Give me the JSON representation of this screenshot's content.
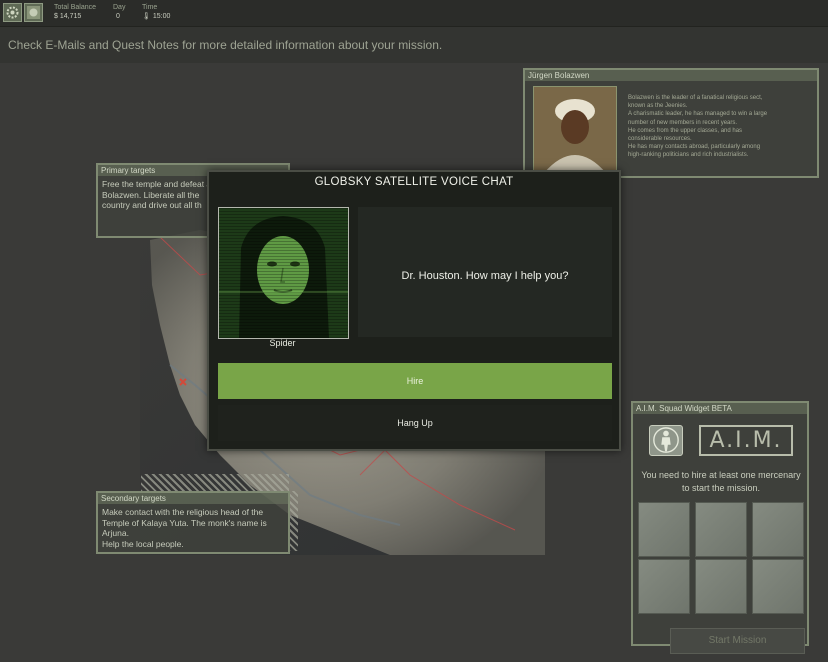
{
  "topbar": {
    "total_balance_label": "Total Balance",
    "total_balance_value": "$ 14,715",
    "day_label": "Day",
    "day_value": "0",
    "time_label": "Time",
    "time_value": "15:00"
  },
  "info": {
    "text": "Check E-Mails and Quest Notes for more detailed information about your mission."
  },
  "jurgen": {
    "title": "Jürgen Bolazwen",
    "lines": [
      "Bolazwen is the leader of a fanatical religious sect,",
      "known as the Jeenies.",
      "A charismatic leader, he has managed to win a large",
      "number of new members in recent years.",
      "He comes from the upper classes, and has",
      "considerable resources.",
      "He has many contacts abroad, particularly among",
      "high-ranking politicians and rich industrialists."
    ]
  },
  "primary": {
    "title": "Primary targets",
    "lines": [
      "Free the temple and defeat Jürgen",
      "Bolazwen. Liberate all the",
      "country and drive out all th"
    ]
  },
  "secondary": {
    "title": "Secondary targets",
    "lines": [
      "Make contact with the religious head of the",
      "Temple of Kalaya Yuta. The monk's name is",
      "Arjuna.",
      "Help the local people."
    ]
  },
  "aim": {
    "title": "A.I.M. Squad Widget BETA",
    "logo_text": "A.I.M.",
    "message": "You need to hire at least one mercenary to start the mission.",
    "slots": 6
  },
  "start_button": "Start Mission",
  "dialog": {
    "title": "GLOBSKY SATELLITE VOICE CHAT",
    "contact_name": "Spider",
    "message": "Dr. Houston. How may I help you?",
    "hire_label": "Hire",
    "hangup_label": "Hang Up"
  },
  "colors": {
    "background": "#3a3a38",
    "panel_border": "#7f8a72",
    "hire_green": "#79a548",
    "dialog_bg": "#1d201b"
  },
  "icons": [
    "settings-gear-icon",
    "map-emblem-icon",
    "soldier-icon",
    "temperature-icon"
  ]
}
